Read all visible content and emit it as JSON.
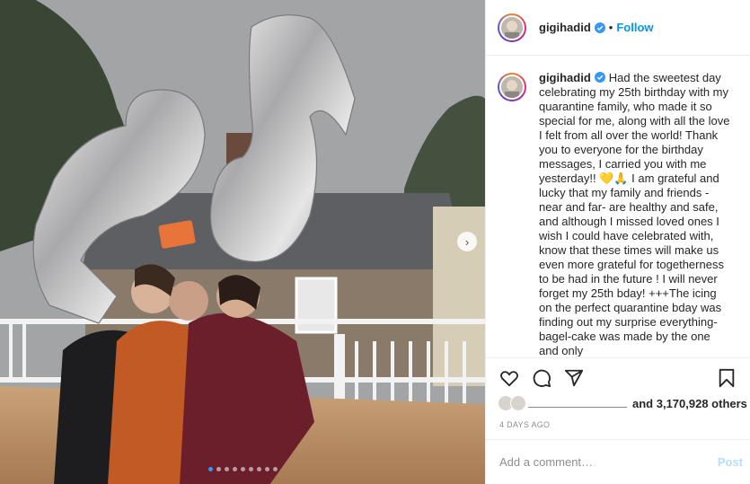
{
  "post": {
    "username": "gigihadid",
    "separator": "•",
    "follow_label": "Follow",
    "caption": "Had the sweetest day celebrating my 25th birthday with my quarantine family, who made it so special for me, along with all the love I felt from all over the world! Thank you to everyone for the birthday messages, I carried you with me yesterday!! 💛🙏 I am grateful and lucky that my family and friends -near and far- are healthy and safe, and although I missed loved ones I wish I could have celebrated with, know that these times will make us even more grateful for togetherness to be had in the future ! I will never forget my 25th bday! +++The icing on the perfect quarantine bday was finding out my surprise everything-bagel-cake was made by the one and only",
    "likes_text": "and 3,170,928 others",
    "date": "4 DAYS AGO",
    "comment_placeholder": "Add a comment…",
    "post_label": "Post"
  },
  "carousel": {
    "slide_count": 9,
    "active_index": 0
  },
  "icons": {
    "verified": "verified-badge-icon",
    "like": "heart-icon",
    "comment": "comment-icon",
    "share": "send-icon",
    "save": "bookmark-icon",
    "next": "chevron-right-icon"
  },
  "colors": {
    "follow": "#0095f6",
    "verified": "#3897f0",
    "post_disabled": "#b2dffc",
    "muted": "#8e8e8e"
  }
}
